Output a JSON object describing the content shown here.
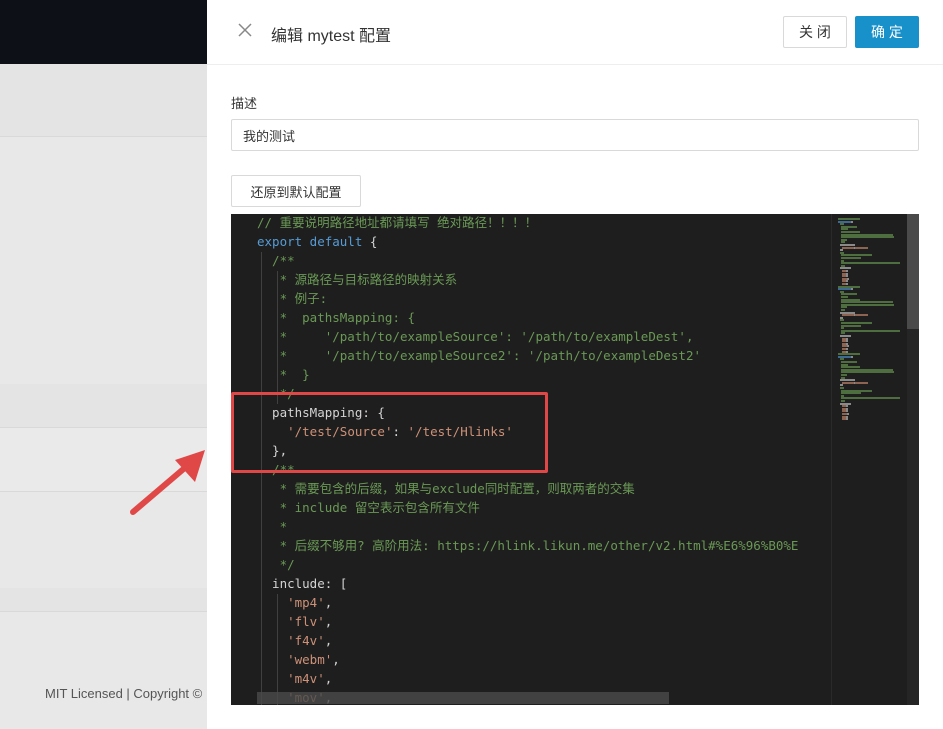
{
  "background": {
    "footer": "MIT Licensed | Copyright ©"
  },
  "drawer": {
    "title": "编辑 mytest 配置",
    "close_button": "关 闭",
    "ok_button": "确 定",
    "description_label": "描述",
    "description_value": "我的测试",
    "reset_button": "还原到默认配置"
  },
  "editor": {
    "lines": [
      [
        {
          "t": "com",
          "v": "// 重要说明路径地址都请填写 绝对路径！！！！"
        }
      ],
      [
        {
          "t": "kw",
          "v": "export default "
        },
        {
          "t": "txt",
          "v": "{"
        }
      ],
      [
        {
          "t": "com",
          "v": "  /**"
        }
      ],
      [
        {
          "t": "com",
          "v": "   * 源路径与目标路径的映射关系"
        }
      ],
      [
        {
          "t": "com",
          "v": "   * 例子:"
        }
      ],
      [
        {
          "t": "com",
          "v": "   *  pathsMapping: {"
        }
      ],
      [
        {
          "t": "com",
          "v": "   *     '/path/to/exampleSource': '/path/to/exampleDest',"
        }
      ],
      [
        {
          "t": "com",
          "v": "   *     '/path/to/exampleSource2': '/path/to/exampleDest2'"
        }
      ],
      [
        {
          "t": "com",
          "v": "   *  }"
        }
      ],
      [
        {
          "t": "com",
          "v": "   */"
        }
      ],
      [
        {
          "t": "txt",
          "v": "  pathsMapping: {"
        }
      ],
      [
        {
          "t": "txt",
          "v": "    "
        },
        {
          "t": "str",
          "v": "'/test/Source'"
        },
        {
          "t": "txt",
          "v": ": "
        },
        {
          "t": "str",
          "v": "'/test/Hlinks'"
        }
      ],
      [
        {
          "t": "txt",
          "v": "  },"
        }
      ],
      [
        {
          "t": "com",
          "v": "  /**"
        }
      ],
      [
        {
          "t": "com",
          "v": "   * 需要包含的后缀，如果与exclude同时配置，则取两者的交集"
        }
      ],
      [
        {
          "t": "com",
          "v": "   * include 留空表示包含所有文件"
        }
      ],
      [
        {
          "t": "com",
          "v": "   *"
        }
      ],
      [
        {
          "t": "com",
          "v": "   * 后缀不够用? 高阶用法: https://hlink.likun.me/other/v2.html#%E6%96%B0%E"
        }
      ],
      [
        {
          "t": "com",
          "v": "   */"
        }
      ],
      [
        {
          "t": "txt",
          "v": "  include: ["
        }
      ],
      [
        {
          "t": "txt",
          "v": "    "
        },
        {
          "t": "str",
          "v": "'mp4'"
        },
        {
          "t": "txt",
          "v": ","
        }
      ],
      [
        {
          "t": "txt",
          "v": "    "
        },
        {
          "t": "str",
          "v": "'flv'"
        },
        {
          "t": "txt",
          "v": ","
        }
      ],
      [
        {
          "t": "txt",
          "v": "    "
        },
        {
          "t": "str",
          "v": "'f4v'"
        },
        {
          "t": "txt",
          "v": ","
        }
      ],
      [
        {
          "t": "txt",
          "v": "    "
        },
        {
          "t": "str",
          "v": "'webm'"
        },
        {
          "t": "txt",
          "v": ","
        }
      ],
      [
        {
          "t": "txt",
          "v": "    "
        },
        {
          "t": "str",
          "v": "'m4v'"
        },
        {
          "t": "txt",
          "v": ","
        }
      ],
      [
        {
          "t": "txt",
          "v": "    "
        },
        {
          "t": "str",
          "v": "'mov'"
        },
        {
          "t": "txt",
          "v": ","
        }
      ]
    ]
  },
  "colors": {
    "primary": "#1890c9",
    "annotation": "#e04848",
    "editor_bg": "#1e1e1e"
  }
}
